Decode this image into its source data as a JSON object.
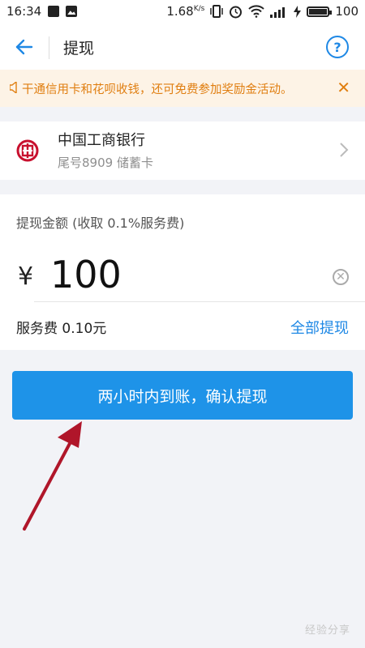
{
  "status_bar": {
    "time": "16:34",
    "speed": "1.68",
    "speed_unit": "K/s",
    "battery": "100"
  },
  "navbar": {
    "title": "提现"
  },
  "notice": {
    "text": "干通信用卡和花呗收钱，还可免费参加奖励金活动。"
  },
  "bank": {
    "name": "中国工商银行",
    "detail": "尾号8909 储蓄卡"
  },
  "amount": {
    "label": "提现金额 (收取 0.1%服务费)",
    "currency_symbol": "¥",
    "value": "100",
    "fee": "服务费 0.10元",
    "withdraw_all": "全部提现"
  },
  "confirm": {
    "label": "两小时内到账，确认提现"
  },
  "watermark": "经验分享",
  "colors": {
    "accent": "#1e93e8",
    "notice_text": "#e07e10",
    "notice_bg": "#fdf3e6",
    "arrow": "#b0162a",
    "bank_logo": "#c8102e"
  }
}
